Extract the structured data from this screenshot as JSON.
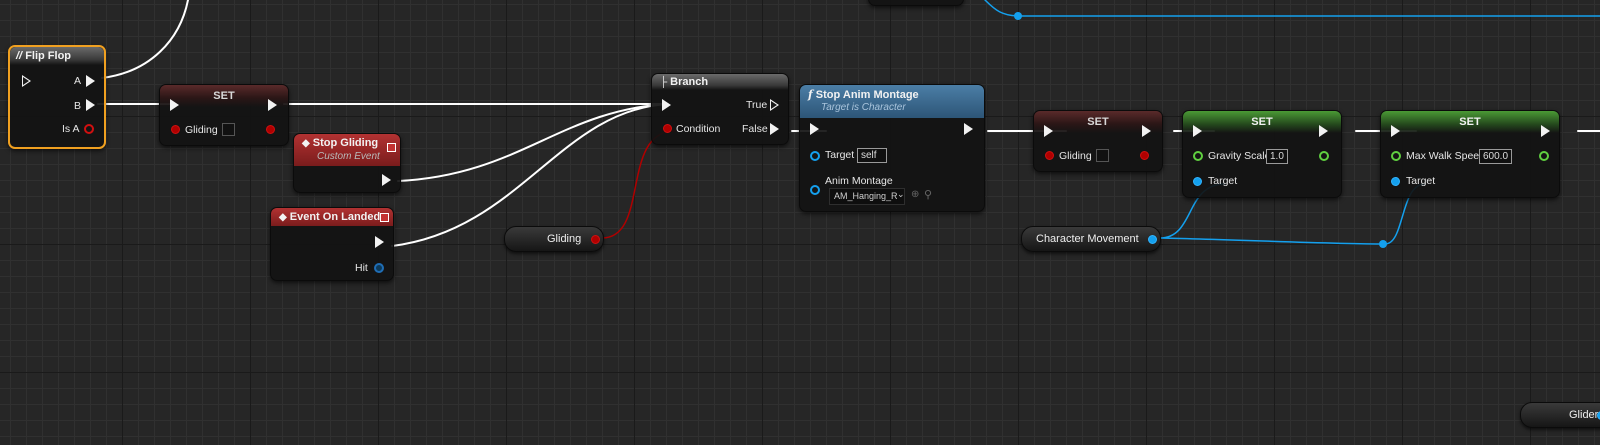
{
  "flip_flop": {
    "title": "Flip Flop",
    "pin_a": "A",
    "pin_b": "B",
    "pin_is_a": "Is A"
  },
  "set_gliding_1": {
    "title": "SET",
    "var": "Gliding"
  },
  "stop_gliding_event": {
    "title": "Stop Gliding",
    "subtitle": "Custom Event"
  },
  "event_on_landed": {
    "title": "Event On Landed",
    "pin_hit": "Hit"
  },
  "gliding_getter": {
    "label": "Gliding"
  },
  "branch": {
    "title": "Branch",
    "pin_condition": "Condition",
    "pin_true": "True",
    "pin_false": "False"
  },
  "stop_anim_montage": {
    "title": "Stop Anim Montage",
    "subtitle": "Target is Character",
    "pin_target": "Target",
    "target_value": "self",
    "pin_anim_montage": "Anim Montage",
    "anim_montage_value": "AM_Hanging_R"
  },
  "set_gliding_2": {
    "title": "SET",
    "var": "Gliding"
  },
  "set_gravity": {
    "title": "SET",
    "var": "Gravity Scale",
    "value": "1.0",
    "pin_target": "Target"
  },
  "set_walk_speed": {
    "title": "SET",
    "var": "Max Walk Speed",
    "value": "600.0",
    "pin_target": "Target"
  },
  "character_movement": {
    "label": "Character Movement"
  },
  "glider": {
    "label": "Glider"
  },
  "colors": {
    "exec": "#ffffff",
    "bool": "#b00000",
    "object": "#14a0ee",
    "float": "#60d040",
    "selection": "#f0a020"
  }
}
